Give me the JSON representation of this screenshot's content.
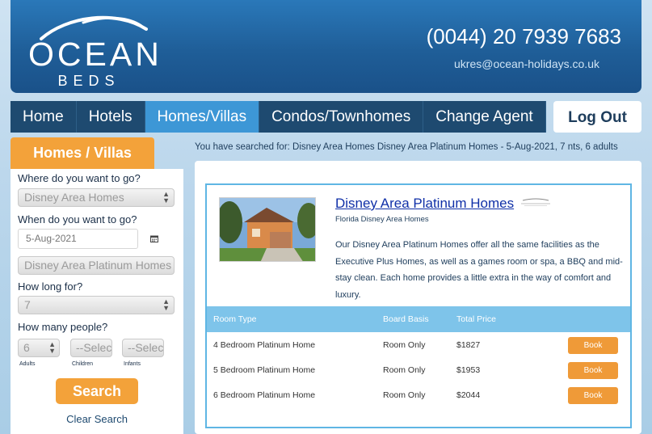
{
  "header": {
    "logo_top": "OCEAN",
    "logo_bottom": "BEDS",
    "phone": "(0044) 20 7939 7683",
    "email": "ukres@ocean-holidays.co.uk"
  },
  "nav": {
    "items": [
      {
        "label": "Home",
        "active": false
      },
      {
        "label": "Hotels",
        "active": false
      },
      {
        "label": "Homes/Villas",
        "active": true
      },
      {
        "label": "Condos/Townhomes",
        "active": false
      },
      {
        "label": "Change Agent",
        "active": false
      }
    ],
    "logout": "Log Out"
  },
  "sidebar": {
    "tab": "Homes / Villas",
    "where_label": "Where do you want to go?",
    "where_value": "Disney Area Homes",
    "when_label": "When do you want to go?",
    "date_value": "5-Aug-2021",
    "type_value": "Disney Area Platinum Homes",
    "howlong_label": "How long for?",
    "nights_value": "7",
    "people_label": "How many people?",
    "adults_value": "6",
    "children_value": "--Select--",
    "infants_value": "--Select--",
    "adults_label": "Adults",
    "children_label": "Children",
    "infants_label": "Infants",
    "search": "Search",
    "clear": "Clear Search"
  },
  "summary": "You have searched for: Disney Area Homes Disney Area Platinum Homes - 5-Aug-2021, 7 nts, 6 adults",
  "result": {
    "title": "Disney Area Platinum Homes",
    "subtitle": "Florida Disney Area Homes",
    "description": "Our Disney Area Platinum Homes offer all the same facilities as the Executive Plus Homes, as well as a games room or spa, a BBQ and mid-stay clean. Each home provides a little extra in the way of comfort and luxury.",
    "columns": [
      "Room Type",
      "Board Basis",
      "Total Price"
    ],
    "rows": [
      {
        "room": "4 Bedroom Platinum Home",
        "board": "Room Only",
        "price": "$1827",
        "book": "Book"
      },
      {
        "room": "5 Bedroom Platinum Home",
        "board": "Room Only",
        "price": "$1953",
        "book": "Book"
      },
      {
        "room": "6 Bedroom Platinum Home",
        "board": "Room Only",
        "price": "$2044",
        "book": "Book"
      }
    ]
  },
  "colors": {
    "header_blue": "#1f5e98",
    "nav_dark": "#1e4a70",
    "nav_active": "#3d97d6",
    "accent_orange": "#f3a23a",
    "table_head": "#7ec4ea"
  }
}
